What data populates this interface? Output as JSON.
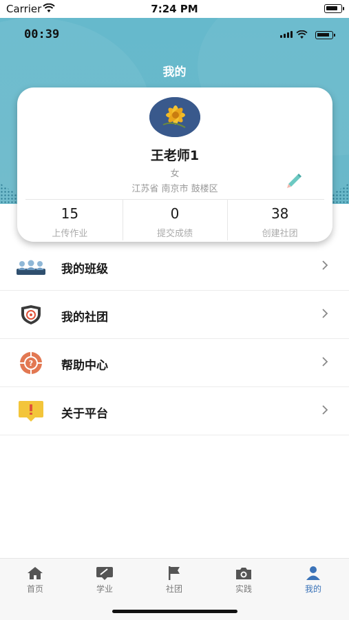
{
  "system_status": {
    "carrier": "Carrier",
    "time": "7:24 PM"
  },
  "app_status": {
    "time": "00:39"
  },
  "header": {
    "title": "我的"
  },
  "profile": {
    "name": "王老师1",
    "gender": "女",
    "location": "江苏省 南京市 鼓楼区",
    "stats": [
      {
        "value": "15",
        "label": "上传作业"
      },
      {
        "value": "0",
        "label": "提交成绩"
      },
      {
        "value": "38",
        "label": "创建社团"
      }
    ]
  },
  "menu": {
    "items": [
      {
        "label": "我的班级",
        "icon": "class-group-icon"
      },
      {
        "label": "我的社团",
        "icon": "club-shield-icon"
      },
      {
        "label": "帮助中心",
        "icon": "help-icon"
      },
      {
        "label": "关于平台",
        "icon": "about-info-icon"
      }
    ]
  },
  "tabbar": {
    "items": [
      {
        "label": "首页",
        "icon": "home-icon"
      },
      {
        "label": "学业",
        "icon": "study-icon"
      },
      {
        "label": "社团",
        "icon": "flag-icon"
      },
      {
        "label": "实践",
        "icon": "camera-icon"
      },
      {
        "label": "我的",
        "icon": "person-icon"
      }
    ],
    "active_index": 4
  },
  "colors": {
    "header": "#6ab8c9",
    "active_tab": "#3b73b8",
    "help": "#e27852",
    "about": "#f3c53a"
  }
}
